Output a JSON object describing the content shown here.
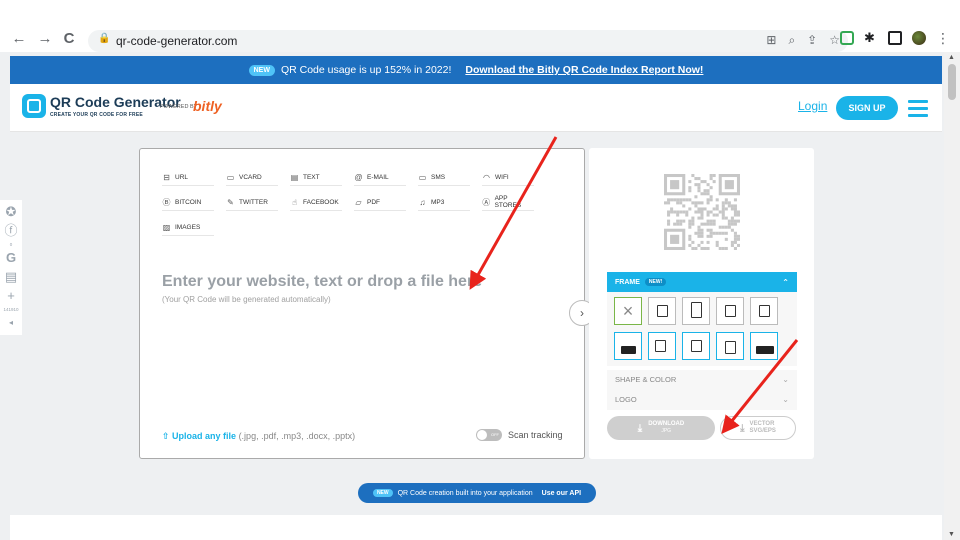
{
  "browser": {
    "url": "qr-code-generator.com",
    "back": "←",
    "forward": "→",
    "reload": "C"
  },
  "banner": {
    "badge": "NEW",
    "text": "QR Code usage is up 152% in 2022!",
    "link": "Download the Bitly QR Code Index Report Now!"
  },
  "header": {
    "logo_title": "QR Code Generator",
    "logo_tagline": "CREATE YOUR QR CODE FOR FREE",
    "powered_by": "POWERED BY",
    "partner": "bitly",
    "login": "Login",
    "signup": "SIGN UP"
  },
  "share": {
    "count_facebook": "0",
    "count_more": "141910"
  },
  "types": [
    {
      "icon": "link-icon",
      "glyph": "⊟",
      "label": "URL"
    },
    {
      "icon": "vcard-icon",
      "glyph": "▭",
      "label": "VCARD"
    },
    {
      "icon": "text-icon",
      "glyph": "▤",
      "label": "TEXT"
    },
    {
      "icon": "email-icon",
      "glyph": "@",
      "label": "E-MAIL"
    },
    {
      "icon": "sms-icon",
      "glyph": "▭",
      "label": "SMS"
    },
    {
      "icon": "wifi-icon",
      "glyph": "◠",
      "label": "WIFI"
    },
    {
      "icon": "bitcoin-icon",
      "glyph": "Ⓑ",
      "label": "BITCOIN"
    },
    {
      "icon": "twitter-icon",
      "glyph": "✎",
      "label": "TWITTER"
    },
    {
      "icon": "facebook-icon",
      "glyph": "☝",
      "label": "FACEBOOK"
    },
    {
      "icon": "pdf-icon",
      "glyph": "▱",
      "label": "PDF"
    },
    {
      "icon": "music-icon",
      "glyph": "♫",
      "label": "MP3"
    },
    {
      "icon": "appstore-icon",
      "glyph": "Ⓐ",
      "label": "APP STORES"
    },
    {
      "icon": "images-icon",
      "glyph": "▨",
      "label": "IMAGES"
    }
  ],
  "content": {
    "heading": "Enter your website, text or drop a file here",
    "subtext": "(Your QR Code will be generated automatically)",
    "upload_link": "Upload any file",
    "upload_formats": " (.jpg, .pdf, .mp3, .docx, .pptx)",
    "toggle_state": "OFF",
    "scan_tracking": "Scan tracking"
  },
  "panel": {
    "frame_label": "FRAME",
    "frame_badge": "NEW!",
    "shape_color": "SHAPE & COLOR",
    "logo": "LOGO",
    "download_label": "DOWNLOAD",
    "download_format": "JPG",
    "vector_label": "VECTOR",
    "vector_format": "SVG/EPS"
  },
  "api": {
    "badge": "NEW",
    "text": "QR Code creation built into your application",
    "link": "Use our API"
  },
  "colors": {
    "brand": "#1ab3e8",
    "banner": "#1d6fbf",
    "annotation": "#e8231c"
  }
}
